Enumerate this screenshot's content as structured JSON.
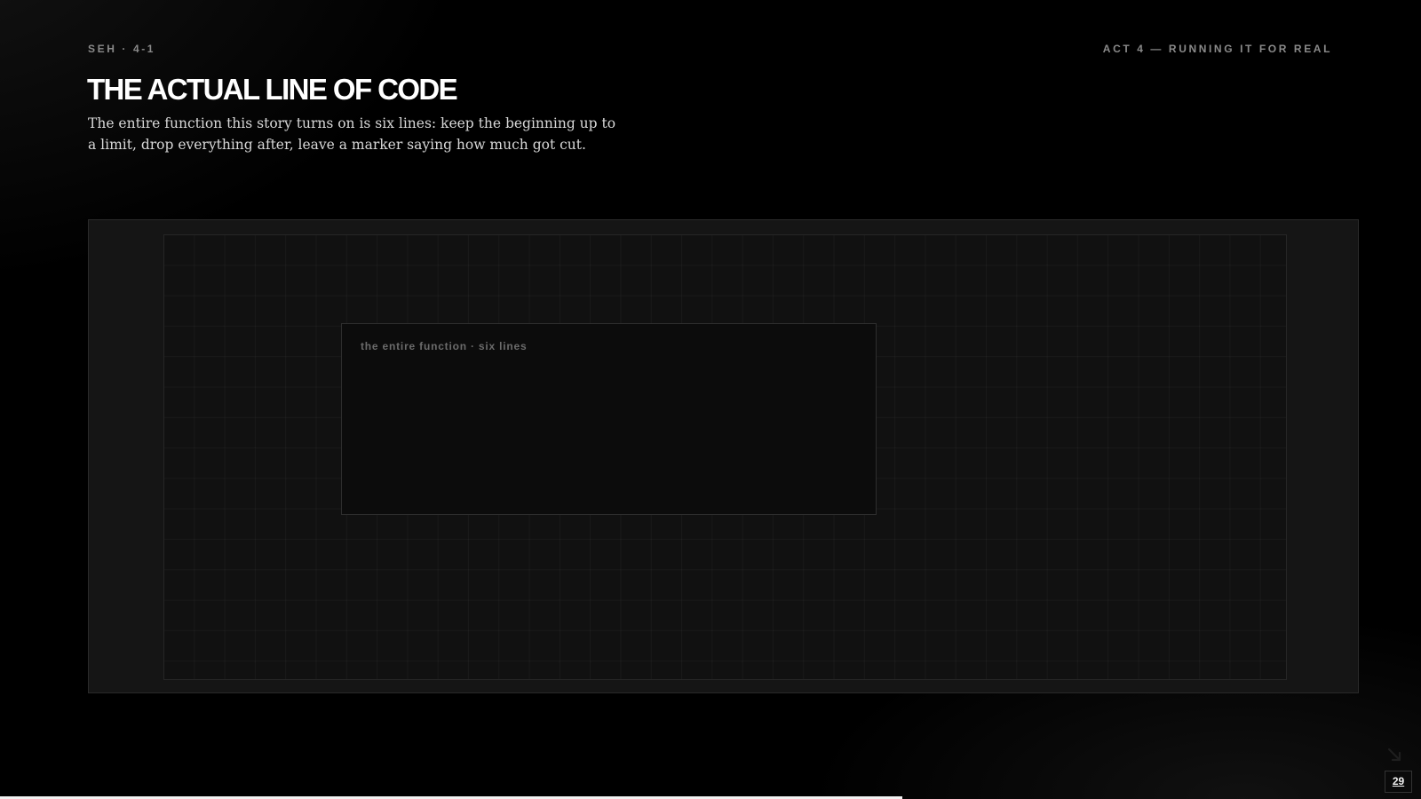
{
  "header": {
    "eyebrow": "SEH · 4-1",
    "act_label": "ACT 4 — RUNNING IT FOR REAL"
  },
  "slide": {
    "title": "THE ACTUAL LINE OF CODE",
    "subtitle": "The entire function this story turns on is six lines: keep the beginning up to a limit, drop everything after, leave a marker saying how much got cut."
  },
  "code_card": {
    "label": "the entire function · six lines"
  },
  "footer": {
    "page_number": "29",
    "progress_fraction": 0.635
  },
  "colors": {
    "background": "#000000",
    "title": "#ffffff",
    "muted_label": "#8a8a8a",
    "progress": "#f2f2f2"
  },
  "icons": {
    "corner": "chevron-down-right-icon"
  }
}
